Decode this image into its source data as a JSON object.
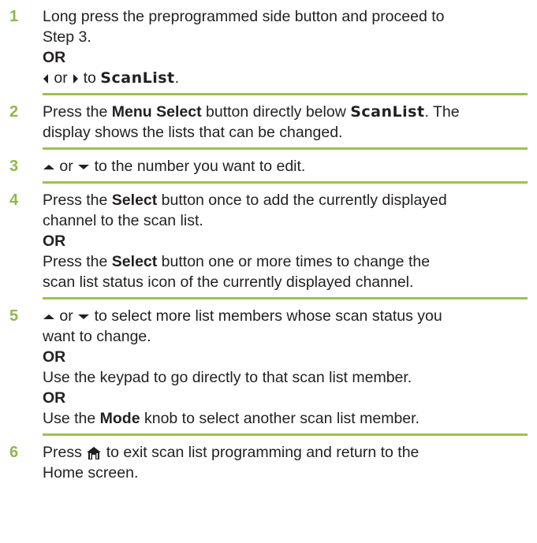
{
  "steps": [
    {
      "number": "1",
      "line1": "Long press the preprogrammed side button and proceed to",
      "line2": "Step 3.",
      "or": "OR",
      "nav_or": "or",
      "nav_to": "to",
      "screen_label": "ScanList",
      "period": "."
    },
    {
      "number": "2",
      "press": "Press the",
      "button": "Menu Select",
      "after_button": "button directly below",
      "screen_label": "ScanList",
      "after_label": ". The",
      "line2": "display shows the lists that can be changed."
    },
    {
      "number": "3",
      "or_word": "or",
      "text": "to the number you want to edit."
    },
    {
      "number": "4",
      "press": "Press the",
      "button": "Select",
      "after_button": "button once to add the currently displayed",
      "line2": "channel to the scan list.",
      "or": "OR",
      "press2": "Press the",
      "button2": "Select",
      "after_button2": "button one or more times to change the",
      "line5": "scan list status icon of the currently displayed channel."
    },
    {
      "number": "5",
      "or_word": "or",
      "text": "to select more list members whose scan status you",
      "line2": "want to change.",
      "or": "OR",
      "line4": "Use the keypad to go directly to that scan list member.",
      "or2": "OR",
      "use": "Use the",
      "knob": "Mode",
      "after_knob": "knob to select another scan list member."
    },
    {
      "number": "6",
      "press": "Press",
      "after_icon": "to exit scan list programming and return to the",
      "line2": "Home screen."
    }
  ],
  "icons": {
    "left": "left-arrow-icon",
    "right": "right-arrow-icon",
    "up": "up-arrow-icon",
    "down": "down-arrow-icon",
    "home": "home-icon"
  },
  "colors": {
    "step_number": "#8fb84a",
    "rule": "#9cc24e",
    "text": "#231f20"
  }
}
